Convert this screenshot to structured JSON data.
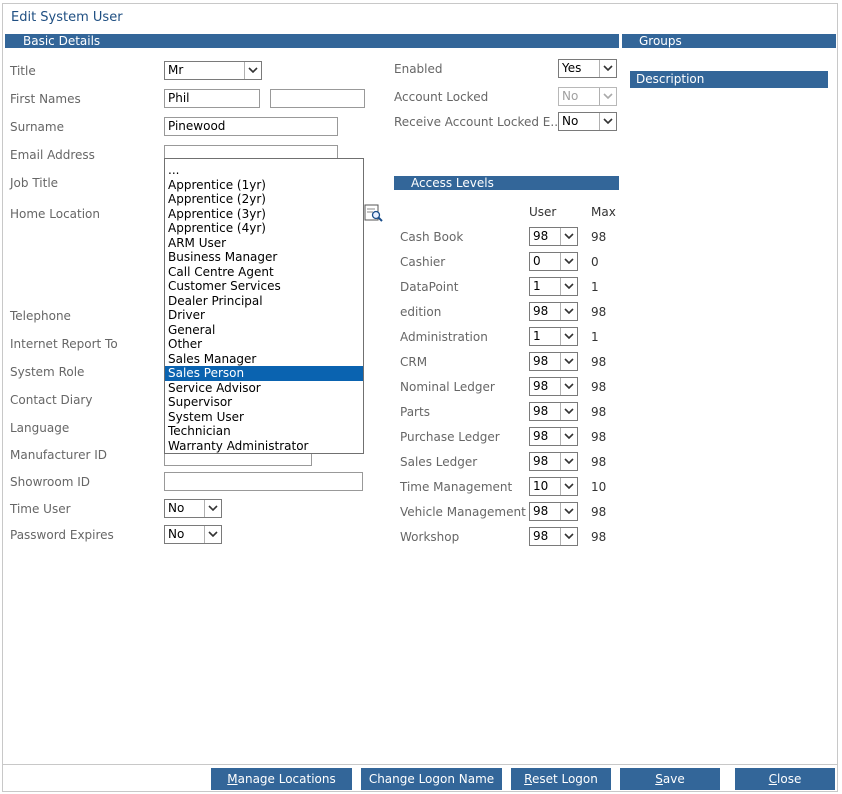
{
  "window": {
    "title": "Edit System User"
  },
  "sections": {
    "basic_details": "Basic Details",
    "groups": "Groups",
    "access_levels": "Access Levels"
  },
  "groups": {
    "description_header": "Description"
  },
  "labels": {
    "title": "Title",
    "first_names": "First Names",
    "surname": "Surname",
    "email": "Email Address",
    "job_title": "Job Title",
    "home_location": "Home Location",
    "telephone": "Telephone",
    "internet_report_to": "Internet Report To",
    "system_role": "System Role",
    "contact_diary": "Contact Diary",
    "language": "Language",
    "manufacturer_id": "Manufacturer ID",
    "showroom_id": "Showroom ID",
    "time_user": "Time User",
    "password_expires": "Password Expires",
    "enabled": "Enabled",
    "account_locked": "Account Locked",
    "receive_account_locked": "Receive Account Locked E..."
  },
  "values": {
    "title": "Mr",
    "first_name_1": "Phil",
    "first_name_2": "",
    "surname": "Pinewood",
    "email": "",
    "showroom_id": "",
    "time_user": "No",
    "password_expires": "No",
    "enabled": "Yes",
    "account_locked": "No",
    "receive_account_locked": "No"
  },
  "job_title_options": [
    "...",
    "Apprentice (1yr)",
    "Apprentice (2yr)",
    "Apprentice (3yr)",
    "Apprentice (4yr)",
    "ARM User",
    "Business Manager",
    "Call Centre Agent",
    "Customer Services",
    "Dealer Principal",
    "Driver",
    "General",
    "Other",
    "Sales Manager",
    "Sales Person",
    "Service Advisor",
    "Supervisor",
    "System User",
    "Technician",
    "Warranty Administrator"
  ],
  "job_title_selected": "Sales Person",
  "access_levels": {
    "col_user": "User",
    "col_max": "Max",
    "rows": [
      {
        "name": "Cash Book",
        "user": "98",
        "max": "98"
      },
      {
        "name": "Cashier",
        "user": "0",
        "max": "0"
      },
      {
        "name": "DataPoint",
        "user": "1",
        "max": "1"
      },
      {
        "name": "edition",
        "user": "98",
        "max": "98"
      },
      {
        "name": "Administration",
        "user": "1",
        "max": "1"
      },
      {
        "name": "CRM",
        "user": "98",
        "max": "98"
      },
      {
        "name": "Nominal Ledger",
        "user": "98",
        "max": "98"
      },
      {
        "name": "Parts",
        "user": "98",
        "max": "98"
      },
      {
        "name": "Purchase Ledger",
        "user": "98",
        "max": "98"
      },
      {
        "name": "Sales Ledger",
        "user": "98",
        "max": "98"
      },
      {
        "name": "Time Management",
        "user": "10",
        "max": "10"
      },
      {
        "name": "Vehicle Management",
        "user": "98",
        "max": "98"
      },
      {
        "name": "Workshop",
        "user": "98",
        "max": "98"
      }
    ]
  },
  "buttons": {
    "manage_locations": {
      "u": "M",
      "rest": "anage Locations"
    },
    "change_logon_name": {
      "u": "",
      "rest": "Change Logon Name"
    },
    "reset_logon": {
      "u": "R",
      "rest": "eset Logon"
    },
    "save": {
      "u": "S",
      "rest": "ave"
    },
    "close": {
      "u": "C",
      "rest": "lose"
    }
  },
  "colors": {
    "accent": "#336699",
    "selection": "#0a63b0",
    "title": "#1f4f82"
  }
}
